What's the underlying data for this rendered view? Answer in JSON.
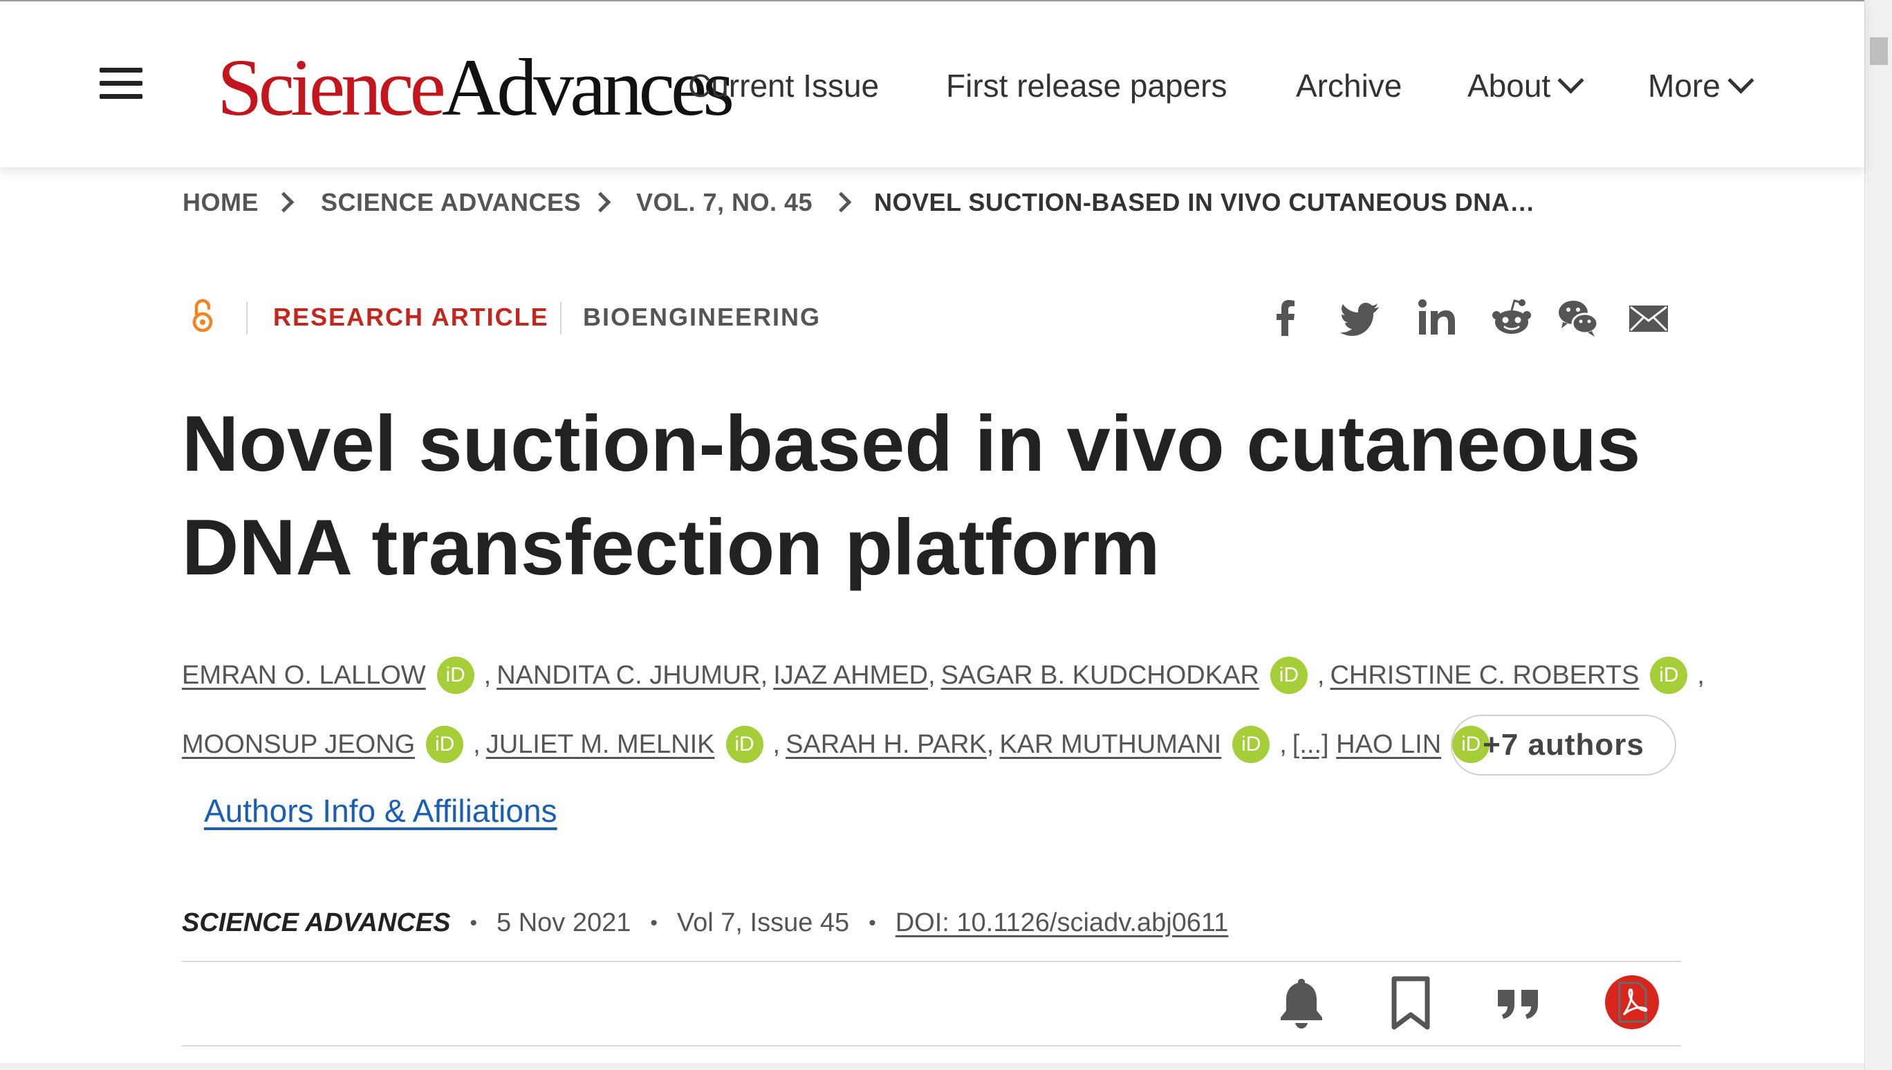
{
  "header": {
    "logo_science": "Science",
    "logo_advances": "Advances",
    "nav": [
      "Current Issue",
      "First release papers",
      "Archive",
      "About",
      "More"
    ]
  },
  "breadcrumb": [
    "HOME",
    "SCIENCE ADVANCES",
    "VOL. 7, NO. 45",
    "NOVEL SUCTION-BASED IN VIVO CUTANEOUS DNA…"
  ],
  "article": {
    "type": "RESEARCH ARTICLE",
    "subject": "BIOENGINEERING",
    "title_line1": "Novel suction-based in vivo cutaneous",
    "title_line2": "DNA transfection platform",
    "authors": [
      "EMRAN O. LALLOW",
      "NANDITA C. JHUMUR",
      "IJAZ AHMED",
      "SAGAR B. KUDCHODKAR",
      "CHRISTINE C. ROBERTS",
      "MOONSUP JEONG",
      "JULIET M. MELNIK",
      "SARAH H. PARK",
      "KAR MUTHUMANI",
      "HAO LIN"
    ],
    "ellipsis": "[...]",
    "orcid_label": "iD",
    "more_authors": "+7 authors",
    "affiliations_link": "Authors Info & Affiliations",
    "journal": "SCIENCE ADVANCES",
    "date": "5 Nov 2021",
    "volume": "Vol 7, Issue 45",
    "doi": "DOI: 10.1126/sciadv.abj0611",
    "separator": "•"
  },
  "colors": {
    "brand_red": "#c4151c",
    "orcid_green": "#a6ce39",
    "link_blue": "#1a5fb4",
    "open_access_orange": "#f58220",
    "pdf_red": "#d9261c"
  },
  "icons": [
    "menu-icon",
    "open-access-icon",
    "facebook-icon",
    "twitter-icon",
    "linkedin-icon",
    "reddit-icon",
    "wechat-icon",
    "email-icon",
    "bell-icon",
    "bookmark-icon",
    "quote-icon",
    "pdf-icon"
  ]
}
